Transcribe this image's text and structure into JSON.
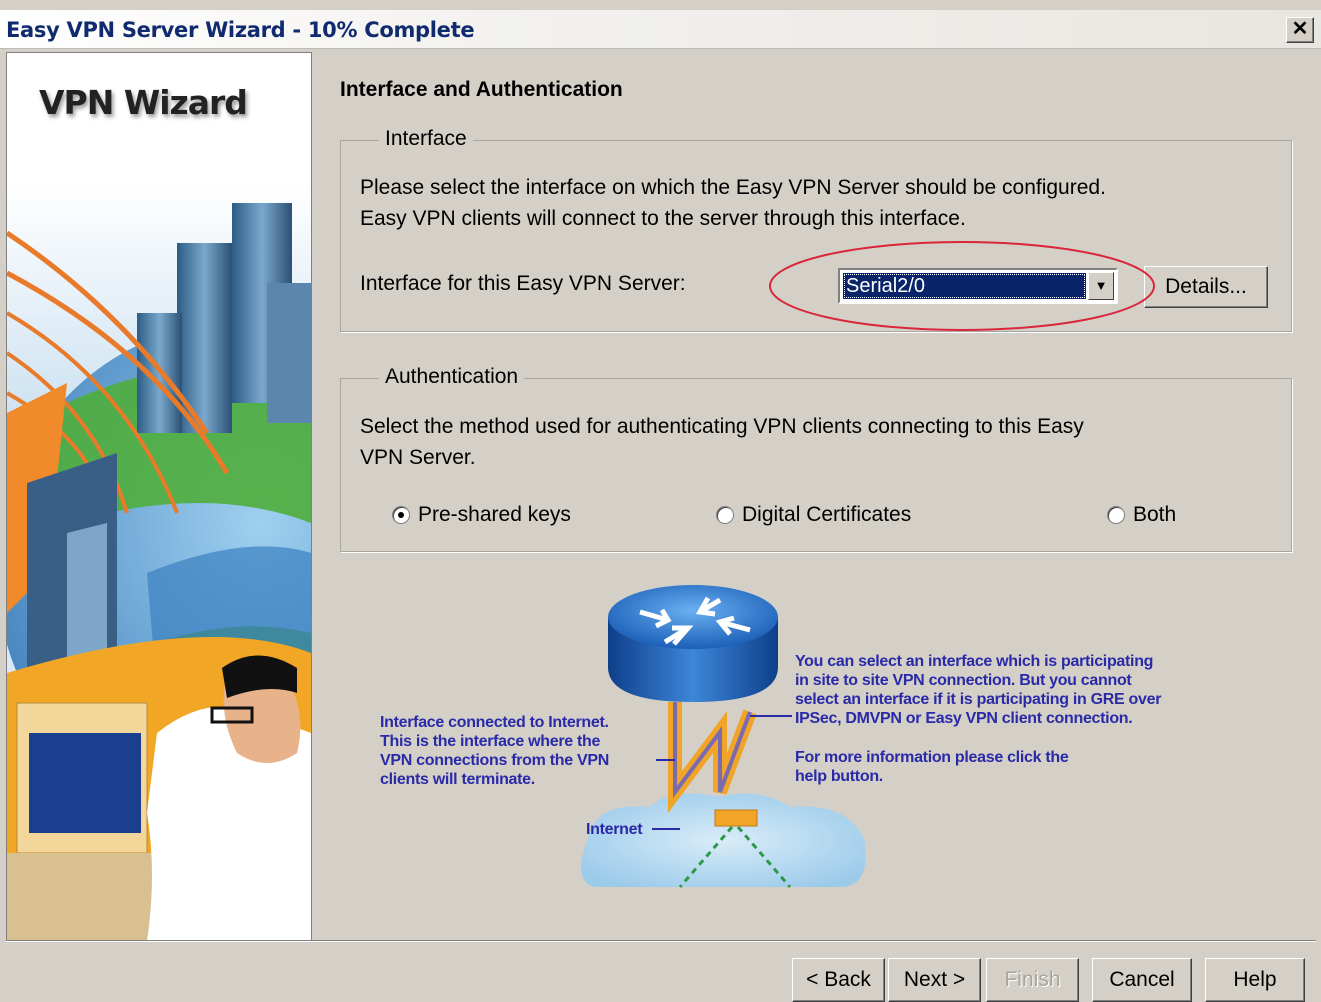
{
  "window": {
    "title": "Easy VPN Server Wizard - 10% Complete",
    "close_glyph": "✕"
  },
  "sidebar": {
    "title": "VPN Wizard"
  },
  "page": {
    "heading": "Interface and Authentication"
  },
  "interface_group": {
    "legend": "Interface",
    "description_line1": "Please select the interface on which the Easy VPN Server should be configured.",
    "description_line2": "Easy VPN clients will connect to the server through this interface.",
    "field_label": "Interface for this Easy VPN Server:",
    "selected_interface": "Serial2/0",
    "details_button": "Details..."
  },
  "authentication_group": {
    "legend": "Authentication",
    "description_line1": "Select the method used for authenticating VPN clients connecting to this Easy",
    "description_line2": "VPN Server.",
    "options": [
      {
        "label": "Pre-shared keys",
        "checked": true
      },
      {
        "label": "Digital Certificates",
        "checked": false
      },
      {
        "label": "Both",
        "checked": false
      }
    ]
  },
  "diagram": {
    "left_note": [
      "Interface connected to Internet.",
      "This is the interface where the",
      "VPN connections from the VPN",
      "clients will terminate."
    ],
    "right_note": [
      "You can select an interface which is participating",
      "in site to site VPN connection. But you cannot",
      "select an interface if it is participating in GRE over",
      "IPSec, DMVPN or Easy VPN client connection."
    ],
    "help_note": [
      "For more information please click the",
      "help button."
    ],
    "internet_label": "Internet"
  },
  "buttons": {
    "back": "< Back",
    "next": "Next >",
    "finish": "Finish",
    "cancel": "Cancel",
    "help": "Help"
  },
  "colors": {
    "dialog_bg": "#d4d0c8",
    "title_text": "#0f2a6e",
    "selection": "#0a246a",
    "highlight_ellipse": "#d9263a",
    "diagram_text": "#2a2aa8"
  }
}
